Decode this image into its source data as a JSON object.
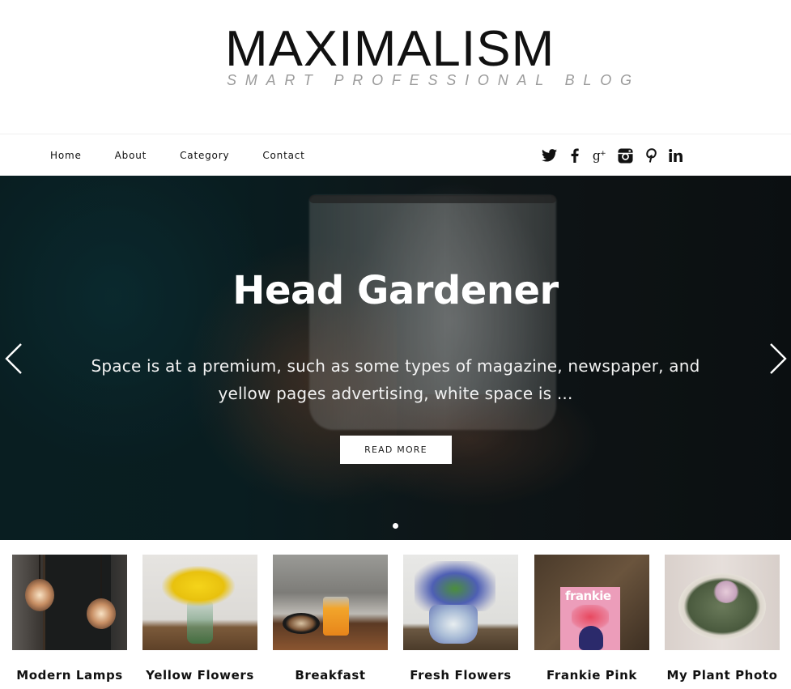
{
  "site": {
    "title": "MAXIMALISM",
    "tagline": "SMART PROFESSIONAL BLOG"
  },
  "nav": {
    "items": [
      {
        "label": "Home"
      },
      {
        "label": "About"
      },
      {
        "label": "Category"
      },
      {
        "label": "Contact"
      }
    ],
    "social": [
      {
        "icon": "twitter-icon",
        "label": "Twitter"
      },
      {
        "icon": "facebook-icon",
        "label": "Facebook"
      },
      {
        "icon": "google-plus-icon",
        "label": "Google+"
      },
      {
        "icon": "instagram-icon",
        "label": "Instagram"
      },
      {
        "icon": "pinterest-icon",
        "label": "Pinterest"
      },
      {
        "icon": "linkedin-icon",
        "label": "LinkedIn"
      }
    ]
  },
  "hero": {
    "title": "Head Gardener",
    "excerpt": "Space is at a premium, such as some types of magazine, newspaper, and yellow pages advertising, white space is ...",
    "button_label": "READ MORE",
    "prev_icon": "chevron-left-icon",
    "next_icon": "chevron-right-icon",
    "slide_count": 1,
    "active_slide": 1
  },
  "gallery": {
    "items": [
      {
        "caption": "Modern Lamps"
      },
      {
        "caption": "Yellow Flowers"
      },
      {
        "caption": "Breakfast"
      },
      {
        "caption": "Fresh Flowers"
      },
      {
        "caption": "Frankie Pink"
      },
      {
        "caption": "My Plant Photo"
      }
    ]
  },
  "colors": {
    "text": "#111111",
    "tagline": "#9b9b9b",
    "hero_bg": "#0c2428",
    "button_bg": "#ffffff"
  }
}
